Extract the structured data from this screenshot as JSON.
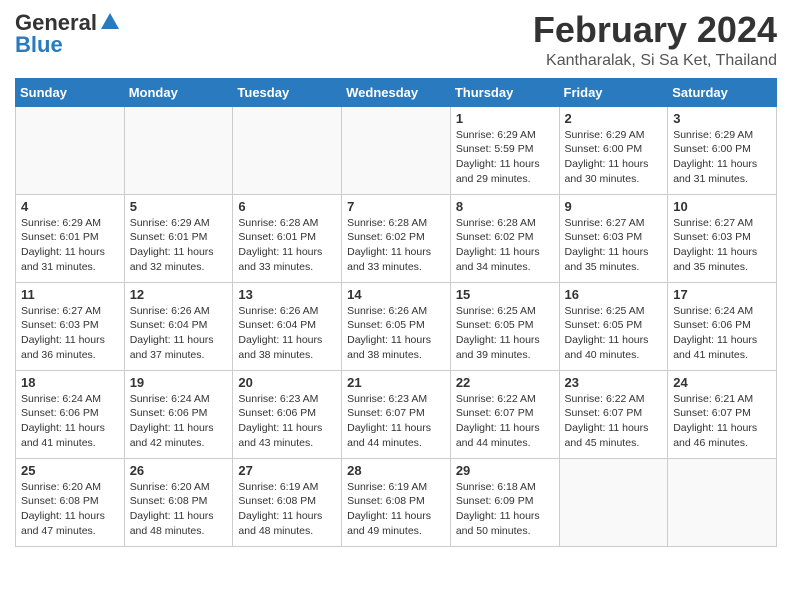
{
  "logo": {
    "general": "General",
    "blue": "Blue"
  },
  "title": {
    "month_year": "February 2024",
    "location": "Kantharalak, Si Sa Ket, Thailand"
  },
  "headers": [
    "Sunday",
    "Monday",
    "Tuesday",
    "Wednesday",
    "Thursday",
    "Friday",
    "Saturday"
  ],
  "weeks": [
    [
      {
        "day": "",
        "info": ""
      },
      {
        "day": "",
        "info": ""
      },
      {
        "day": "",
        "info": ""
      },
      {
        "day": "",
        "info": ""
      },
      {
        "day": "1",
        "info": "Sunrise: 6:29 AM\nSunset: 5:59 PM\nDaylight: 11 hours\nand 29 minutes."
      },
      {
        "day": "2",
        "info": "Sunrise: 6:29 AM\nSunset: 6:00 PM\nDaylight: 11 hours\nand 30 minutes."
      },
      {
        "day": "3",
        "info": "Sunrise: 6:29 AM\nSunset: 6:00 PM\nDaylight: 11 hours\nand 31 minutes."
      }
    ],
    [
      {
        "day": "4",
        "info": "Sunrise: 6:29 AM\nSunset: 6:01 PM\nDaylight: 11 hours\nand 31 minutes."
      },
      {
        "day": "5",
        "info": "Sunrise: 6:29 AM\nSunset: 6:01 PM\nDaylight: 11 hours\nand 32 minutes."
      },
      {
        "day": "6",
        "info": "Sunrise: 6:28 AM\nSunset: 6:01 PM\nDaylight: 11 hours\nand 33 minutes."
      },
      {
        "day": "7",
        "info": "Sunrise: 6:28 AM\nSunset: 6:02 PM\nDaylight: 11 hours\nand 33 minutes."
      },
      {
        "day": "8",
        "info": "Sunrise: 6:28 AM\nSunset: 6:02 PM\nDaylight: 11 hours\nand 34 minutes."
      },
      {
        "day": "9",
        "info": "Sunrise: 6:27 AM\nSunset: 6:03 PM\nDaylight: 11 hours\nand 35 minutes."
      },
      {
        "day": "10",
        "info": "Sunrise: 6:27 AM\nSunset: 6:03 PM\nDaylight: 11 hours\nand 35 minutes."
      }
    ],
    [
      {
        "day": "11",
        "info": "Sunrise: 6:27 AM\nSunset: 6:03 PM\nDaylight: 11 hours\nand 36 minutes."
      },
      {
        "day": "12",
        "info": "Sunrise: 6:26 AM\nSunset: 6:04 PM\nDaylight: 11 hours\nand 37 minutes."
      },
      {
        "day": "13",
        "info": "Sunrise: 6:26 AM\nSunset: 6:04 PM\nDaylight: 11 hours\nand 38 minutes."
      },
      {
        "day": "14",
        "info": "Sunrise: 6:26 AM\nSunset: 6:05 PM\nDaylight: 11 hours\nand 38 minutes."
      },
      {
        "day": "15",
        "info": "Sunrise: 6:25 AM\nSunset: 6:05 PM\nDaylight: 11 hours\nand 39 minutes."
      },
      {
        "day": "16",
        "info": "Sunrise: 6:25 AM\nSunset: 6:05 PM\nDaylight: 11 hours\nand 40 minutes."
      },
      {
        "day": "17",
        "info": "Sunrise: 6:24 AM\nSunset: 6:06 PM\nDaylight: 11 hours\nand 41 minutes."
      }
    ],
    [
      {
        "day": "18",
        "info": "Sunrise: 6:24 AM\nSunset: 6:06 PM\nDaylight: 11 hours\nand 41 minutes."
      },
      {
        "day": "19",
        "info": "Sunrise: 6:24 AM\nSunset: 6:06 PM\nDaylight: 11 hours\nand 42 minutes."
      },
      {
        "day": "20",
        "info": "Sunrise: 6:23 AM\nSunset: 6:06 PM\nDaylight: 11 hours\nand 43 minutes."
      },
      {
        "day": "21",
        "info": "Sunrise: 6:23 AM\nSunset: 6:07 PM\nDaylight: 11 hours\nand 44 minutes."
      },
      {
        "day": "22",
        "info": "Sunrise: 6:22 AM\nSunset: 6:07 PM\nDaylight: 11 hours\nand 44 minutes."
      },
      {
        "day": "23",
        "info": "Sunrise: 6:22 AM\nSunset: 6:07 PM\nDaylight: 11 hours\nand 45 minutes."
      },
      {
        "day": "24",
        "info": "Sunrise: 6:21 AM\nSunset: 6:07 PM\nDaylight: 11 hours\nand 46 minutes."
      }
    ],
    [
      {
        "day": "25",
        "info": "Sunrise: 6:20 AM\nSunset: 6:08 PM\nDaylight: 11 hours\nand 47 minutes."
      },
      {
        "day": "26",
        "info": "Sunrise: 6:20 AM\nSunset: 6:08 PM\nDaylight: 11 hours\nand 48 minutes."
      },
      {
        "day": "27",
        "info": "Sunrise: 6:19 AM\nSunset: 6:08 PM\nDaylight: 11 hours\nand 48 minutes."
      },
      {
        "day": "28",
        "info": "Sunrise: 6:19 AM\nSunset: 6:08 PM\nDaylight: 11 hours\nand 49 minutes."
      },
      {
        "day": "29",
        "info": "Sunrise: 6:18 AM\nSunset: 6:09 PM\nDaylight: 11 hours\nand 50 minutes."
      },
      {
        "day": "",
        "info": ""
      },
      {
        "day": "",
        "info": ""
      }
    ]
  ]
}
